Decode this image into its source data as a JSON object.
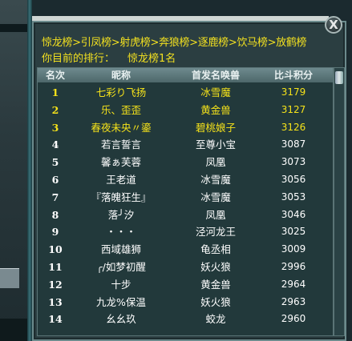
{
  "header": {
    "breadcrumb": "惊龙榜>引凤榜>射虎榜>奔狼榜>逐鹿榜>饮马榜>放鹤榜",
    "rank_label": "你目前的排行：",
    "rank_value": "惊龙榜1名"
  },
  "close_label": "X",
  "table": {
    "columns": [
      "名次",
      "昵称",
      "首发名唤兽",
      "比斗积分"
    ],
    "rows": [
      {
        "rank": "1",
        "name": "七彩り飞扬",
        "pet": "冰雪魔",
        "score": "3179"
      },
      {
        "rank": "2",
        "name": "乐、歪歪",
        "pet": "黄金兽",
        "score": "3127"
      },
      {
        "rank": "3",
        "name": "春夜未央〃鎏",
        "pet": "碧桃娘子",
        "score": "3126"
      },
      {
        "rank": "4",
        "name": "若言誓言",
        "pet": "至尊小宝",
        "score": "3087"
      },
      {
        "rank": "5",
        "name": "馨ぁ芙蓉",
        "pet": "凤凰",
        "score": "3073"
      },
      {
        "rank": "6",
        "name": "王老道",
        "pet": "冰雪魔",
        "score": "3056"
      },
      {
        "rank": "7",
        "name": "『落魄狂生』",
        "pet": "冰雪魔",
        "score": "3053"
      },
      {
        "rank": "8",
        "name": "落╯汐",
        "pet": "凤凰",
        "score": "3046"
      },
      {
        "rank": "9",
        "name": "・・・",
        "pet": "泾河龙王",
        "score": "3025"
      },
      {
        "rank": "10",
        "name": "西域雄狮",
        "pet": "龟丞相",
        "score": "3009"
      },
      {
        "rank": "11",
        "name": "╭/如梦初醒",
        "pet": "妖火狼",
        "score": "2996"
      },
      {
        "rank": "12",
        "name": "十步",
        "pet": "黄金兽",
        "score": "2964"
      },
      {
        "rank": "13",
        "name": "九龙%保温",
        "pet": "妖火狼",
        "score": "2963"
      },
      {
        "rank": "14",
        "name": "幺幺玖",
        "pet": "蛟龙",
        "score": "2960"
      }
    ]
  },
  "colors": {
    "highlight": "#f5e21a",
    "text": "#ffffff",
    "header_bg": "#5d787b"
  }
}
